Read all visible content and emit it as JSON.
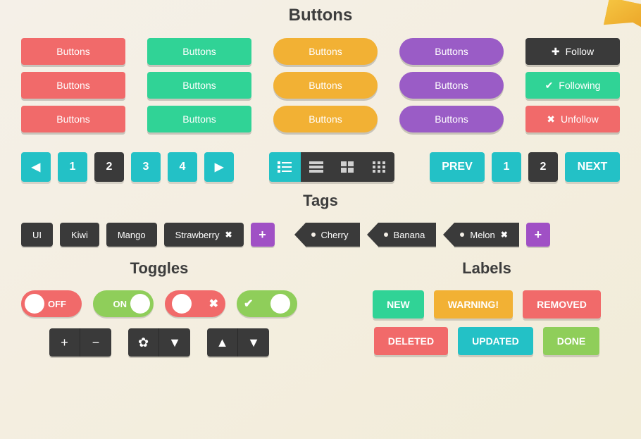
{
  "colors": {
    "red": "#f16a6a",
    "green": "#30d396",
    "orange": "#f2b134",
    "purple": "#9a5cc6",
    "dark": "#3a3a3a",
    "teal": "#23c1c6",
    "magenta": "#a050c5",
    "lime": "#8fce5a"
  },
  "sections": {
    "buttons_title": "Buttons",
    "tags_title": "Tags",
    "toggles_title": "Toggles",
    "labels_title": "Labels"
  },
  "buttons": {
    "generic_label": "Buttons",
    "follow": "Follow",
    "following": "Following",
    "unfollow": "Unfollow"
  },
  "pager": {
    "pages": [
      "1",
      "2",
      "3",
      "4"
    ],
    "active": "2",
    "prev": "PREV",
    "next": "NEXT",
    "group2": [
      "1",
      "2"
    ],
    "group2_active": "2"
  },
  "tags": {
    "plain": [
      "UI",
      "Kiwi",
      "Mango"
    ],
    "plain_closable": "Strawberry",
    "arrow": [
      "Cherry",
      "Banana"
    ],
    "arrow_closable": "Melon"
  },
  "toggles": {
    "off_label": "OFF",
    "on_label": "ON"
  },
  "labels": {
    "new": "NEW",
    "warning": "WARNING!",
    "removed": "REMOVED",
    "deleted": "DELETED",
    "updated": "UPDATED",
    "done": "DONE"
  }
}
